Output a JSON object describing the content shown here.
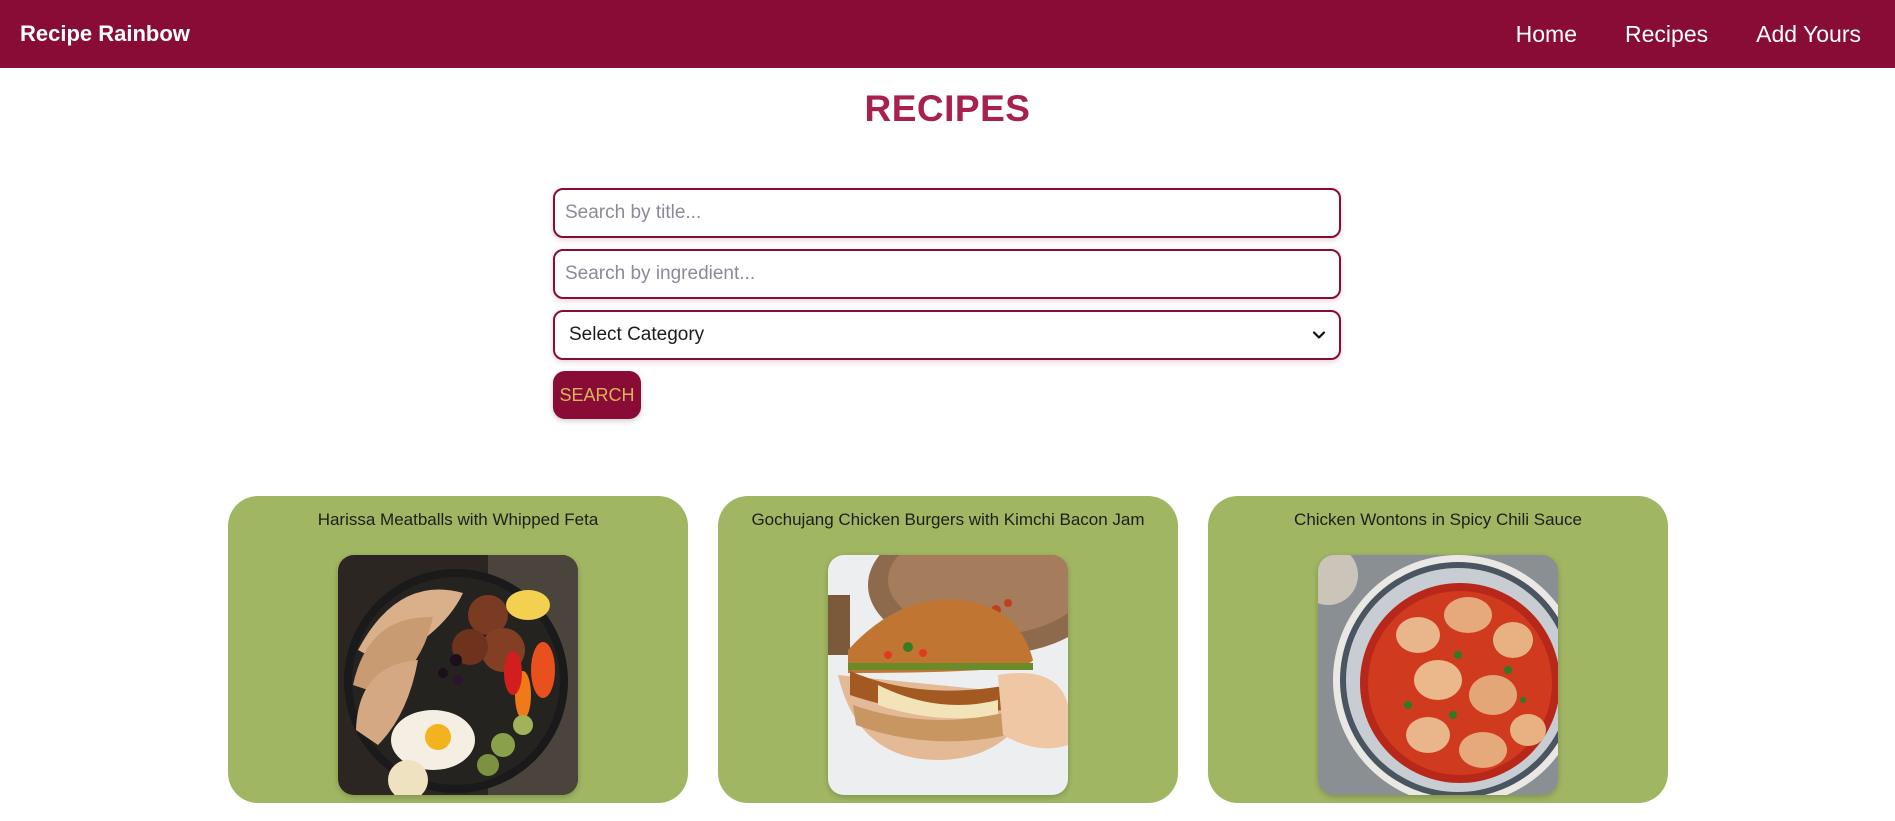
{
  "navbar": {
    "brand": "Recipe Rainbow",
    "links": [
      {
        "label": "Home"
      },
      {
        "label": "Recipes"
      },
      {
        "label": "Add Yours"
      }
    ]
  },
  "page": {
    "title": "RECIPES"
  },
  "search": {
    "title_placeholder": "Search by title...",
    "ingredient_placeholder": "Search by ingredient...",
    "category_selected": "Select Category",
    "button_label": "SEARCH"
  },
  "recipes": [
    {
      "title": "Harissa Meatballs with Whipped Feta",
      "image_icon": "meatball-plate-photo"
    },
    {
      "title": "Gochujang Chicken Burgers with Kimchi Bacon Jam",
      "image_icon": "chicken-burger-photo"
    },
    {
      "title": "Chicken Wontons in Spicy Chili Sauce",
      "image_icon": "wonton-bowl-photo"
    }
  ],
  "colors": {
    "brand": "#880c36",
    "title": "#a8204d",
    "card": "#a0b662",
    "button_text": "#d9b45a"
  }
}
